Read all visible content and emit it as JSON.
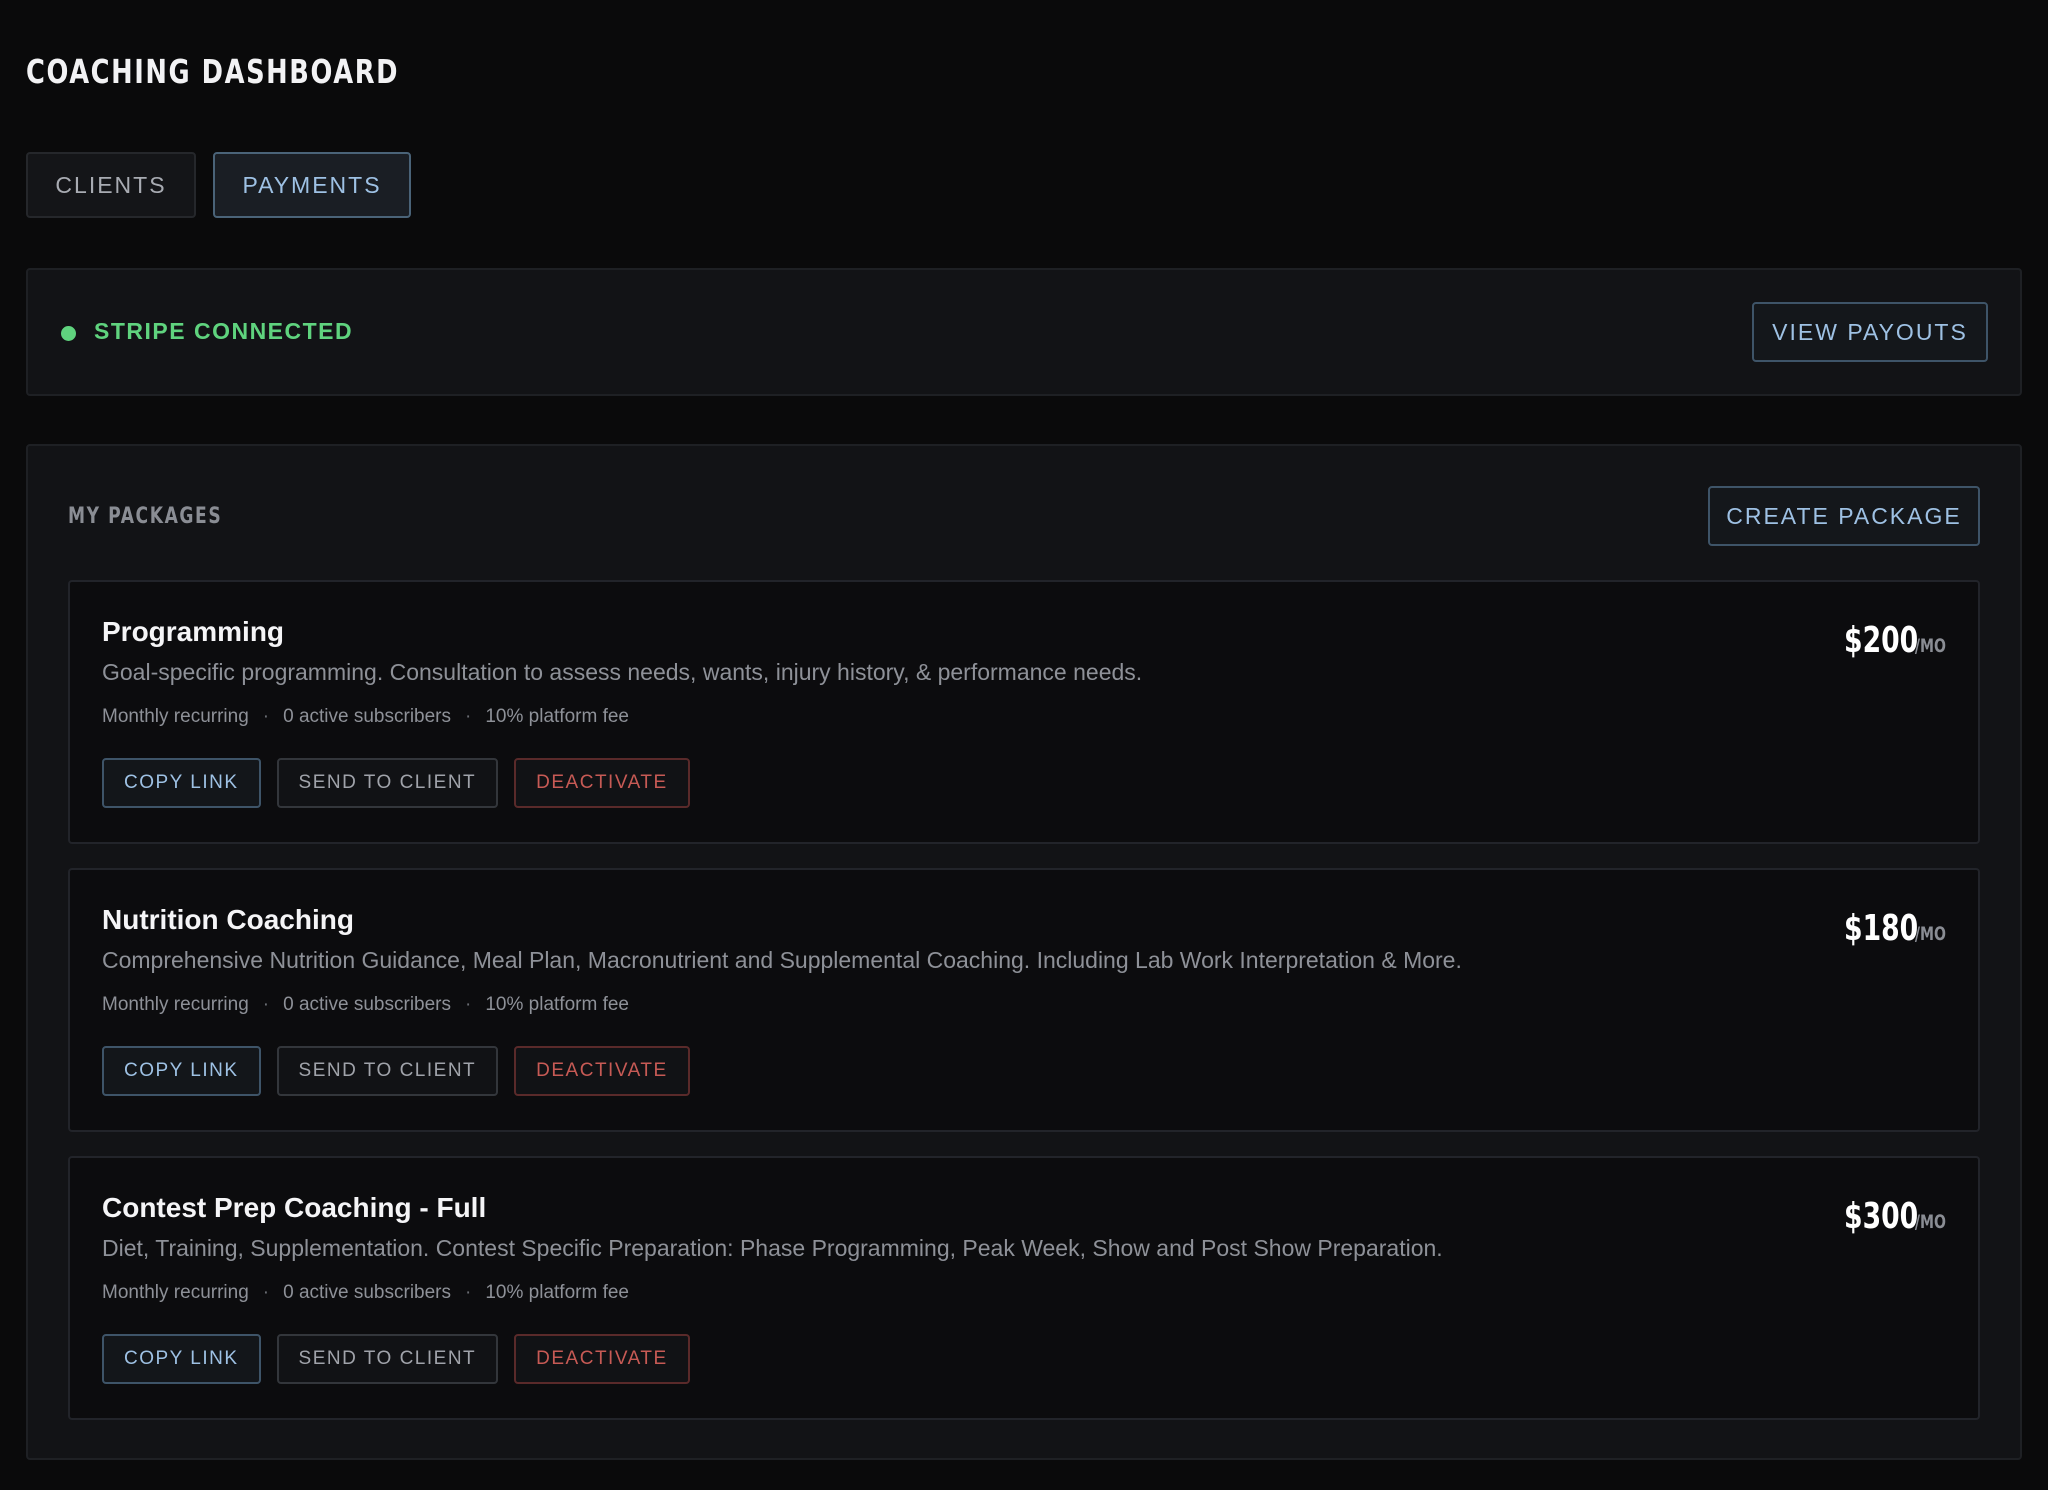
{
  "page": {
    "title": "COACHING DASHBOARD"
  },
  "tabs": [
    {
      "label": "CLIENTS",
      "active": false
    },
    {
      "label": "PAYMENTS",
      "active": true
    }
  ],
  "stripe": {
    "status": "STRIPE CONNECTED",
    "status_color": "#5fd37e",
    "view_payouts_label": "VIEW PAYOUTS"
  },
  "packages": {
    "heading": "MY PACKAGES",
    "create_label": "CREATE PACKAGE",
    "items": [
      {
        "name": "Programming",
        "description": "Goal-specific programming. Consultation to assess needs, wants, injury history, & performance needs.",
        "billing": "Monthly recurring",
        "subscribers": "0 active subscribers",
        "fee": "10% platform fee",
        "price": "$200",
        "unit": "/MO",
        "copy_label": "COPY LINK",
        "send_label": "SEND TO CLIENT",
        "deactivate_label": "DEACTIVATE"
      },
      {
        "name": "Nutrition Coaching",
        "description": "Comprehensive Nutrition Guidance, Meal Plan, Macronutrient and Supplemental Coaching. Including Lab Work Interpretation & More.",
        "billing": "Monthly recurring",
        "subscribers": "0 active subscribers",
        "fee": "10% platform fee",
        "price": "$180",
        "unit": "/MO",
        "copy_label": "COPY LINK",
        "send_label": "SEND TO CLIENT",
        "deactivate_label": "DEACTIVATE"
      },
      {
        "name": "Contest Prep Coaching - Full",
        "description": "Diet, Training, Supplementation. Contest Specific Preparation: Phase Programming, Peak Week, Show and Post Show Preparation.",
        "billing": "Monthly recurring",
        "subscribers": "0 active subscribers",
        "fee": "10% platform fee",
        "price": "$300",
        "unit": "/MO",
        "copy_label": "COPY LINK",
        "send_label": "SEND TO CLIENT",
        "deactivate_label": "DEACTIVATE"
      }
    ]
  },
  "colors": {
    "background": "#0a0a0b",
    "accent_blue": "#9ec1e4",
    "success_green": "#5fd37e",
    "danger_red": "#c75a55"
  }
}
